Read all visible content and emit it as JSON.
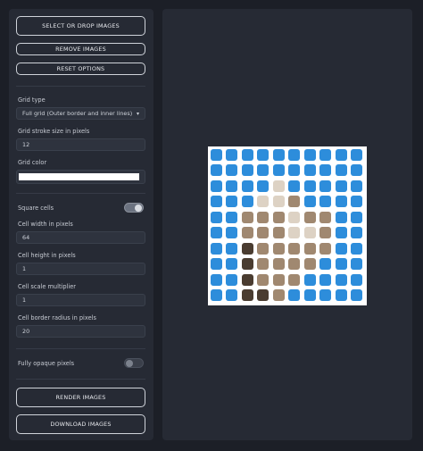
{
  "sidebar": {
    "buttons": {
      "select": "SELECT OR DROP IMAGES",
      "remove": "REMOVE IMAGES",
      "reset": "RESET OPTIONS",
      "render": "RENDER IMAGES",
      "download": "DOWNLOAD IMAGES"
    },
    "grid_type": {
      "label": "Grid type",
      "value": "Full grid (Outer border and inner lines)"
    },
    "grid_stroke": {
      "label": "Grid stroke size in pixels",
      "value": "12"
    },
    "grid_color": {
      "label": "Grid color",
      "value": "#ffffff"
    },
    "square_cells": {
      "label": "Square cells",
      "on": true
    },
    "cell_width": {
      "label": "Cell width in pixels",
      "value": "64"
    },
    "cell_height": {
      "label": "Cell height in pixels",
      "value": "1"
    },
    "cell_scale": {
      "label": "Cell scale multiplier",
      "value": "1"
    },
    "cell_radius": {
      "label": "Cell border radius in pixels",
      "value": "20"
    },
    "opaque": {
      "label": "Fully opaque pixels",
      "on": false
    }
  },
  "preview": {
    "cell_color": "#2d8ddb",
    "grid_color": "#ffffff",
    "columns": 10,
    "rows": 10
  },
  "icons": {
    "dropdown": "chevron-down-icon"
  }
}
